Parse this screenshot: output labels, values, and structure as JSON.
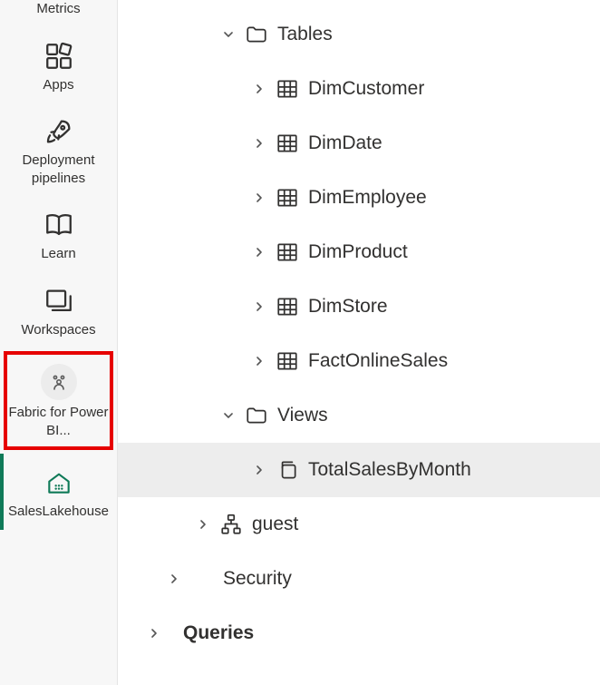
{
  "sidebar": {
    "items": [
      {
        "label": "Metrics"
      },
      {
        "label": "Apps"
      },
      {
        "label": "Deployment pipelines"
      },
      {
        "label": "Learn"
      },
      {
        "label": "Workspaces"
      },
      {
        "label": "Fabric for Power BI..."
      },
      {
        "label": "SalesLakehouse"
      }
    ]
  },
  "tree": {
    "tables_folder": "Tables",
    "tables": [
      "DimCustomer",
      "DimDate",
      "DimEmployee",
      "DimProduct",
      "DimStore",
      "FactOnlineSales"
    ],
    "views_folder": "Views",
    "views": [
      "TotalSalesByMonth"
    ],
    "schema_guest": "guest",
    "security_label": "Security",
    "queries_label": "Queries"
  }
}
